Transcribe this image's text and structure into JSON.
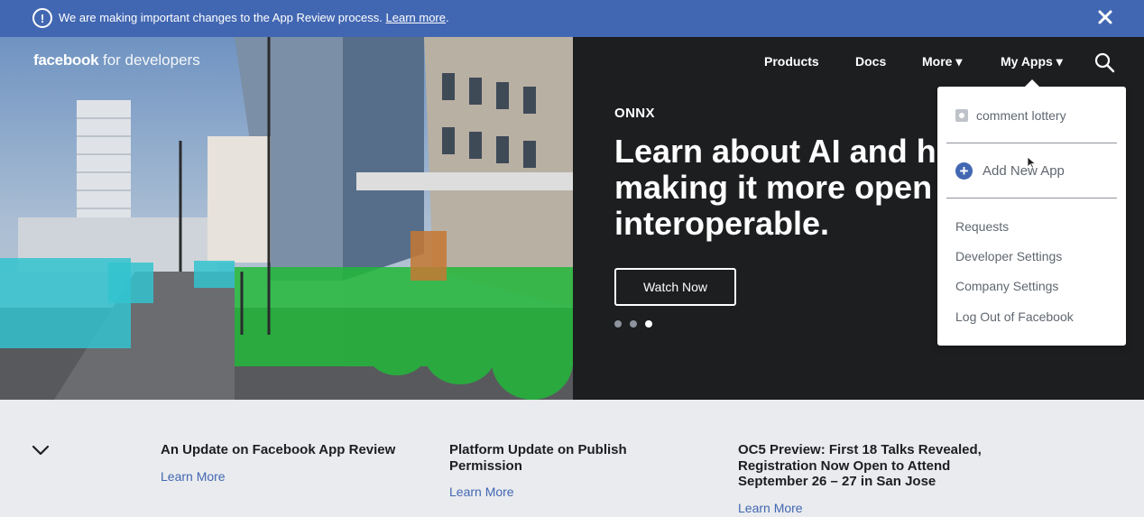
{
  "banner": {
    "text": "We are making important changes to the App Review process.",
    "link": "Learn more",
    "suffix": ".",
    "bg_color": "#4267b2"
  },
  "nav": {
    "logo_brand": "facebook",
    "logo_sub": "for developers",
    "products": "Products",
    "docs": "Docs",
    "more": "More ▾",
    "my_apps": "My Apps ▾"
  },
  "hero": {
    "kicker": "ONNX",
    "title_line1": "Learn about AI and ho",
    "title_line2": "making it more open a",
    "title_line3": "interoperable.",
    "button": "Watch Now",
    "slide_count": 3,
    "active_slide": 3
  },
  "dropdown": {
    "app_name": "comment lottery",
    "add_app": "Add New App",
    "links": [
      "Requests",
      "Developer Settings",
      "Company Settings",
      "Log Out of Facebook"
    ]
  },
  "news": [
    {
      "title": "An Update on Facebook App Review",
      "link": "Learn More"
    },
    {
      "title": "Platform Update on Publish Permission",
      "link": "Learn More"
    },
    {
      "title": "OC5 Preview: First 18 Talks Revealed, Registration Now Open to Attend September 26 – 27 in San Jose",
      "link": "Learn More"
    }
  ],
  "colors": {
    "accent": "#4267b2",
    "hero_bg": "#1d1e20",
    "bottom_bg": "#e9ebee"
  }
}
